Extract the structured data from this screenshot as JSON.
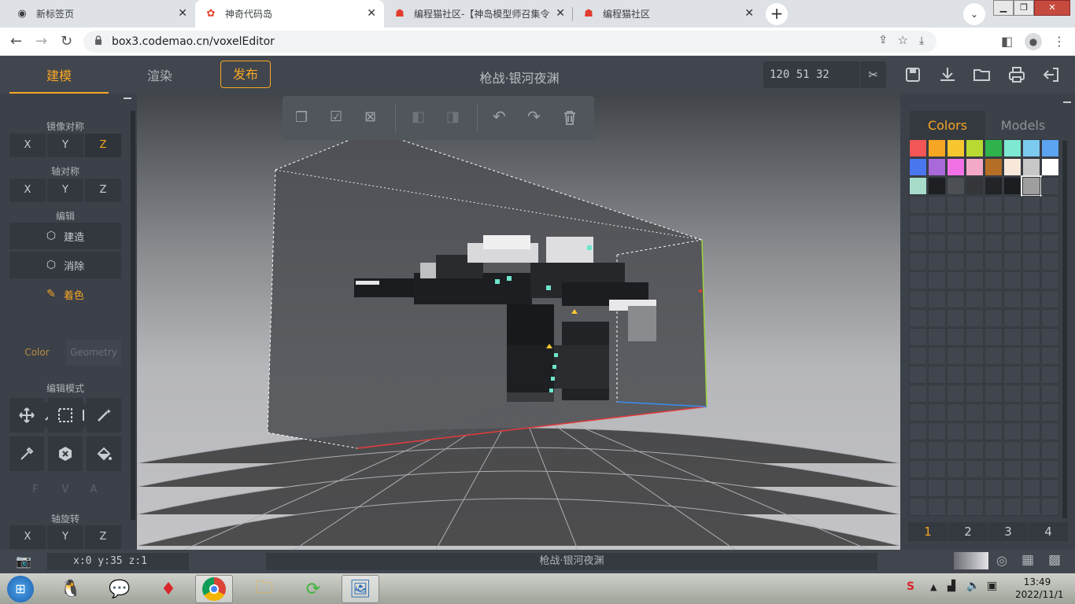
{
  "browser": {
    "tabs": [
      {
        "title": "新标签页",
        "icon": "chrome-icon"
      },
      {
        "title": "神奇代码岛",
        "icon": "codemao-icon"
      },
      {
        "title": "编程猫社区-【神岛模型师召集令",
        "icon": "cat-icon"
      },
      {
        "title": "编程猫社区",
        "icon": "cat-icon"
      }
    ],
    "url": "box3.codemao.cn/voxelEditor"
  },
  "app": {
    "modes": [
      "建模",
      "渲染"
    ],
    "publish": "发布",
    "title": "枪战·银河夜渊",
    "coords": "120 51 32"
  },
  "left": {
    "mirror_label": "镜像对称",
    "axis_label": "轴对称",
    "edit_label": "编辑",
    "axes": [
      "X",
      "Y",
      "Z"
    ],
    "build": "建造",
    "erase": "消除",
    "paint": "着色",
    "color_tab": "Color",
    "geometry_tab": "Geometry",
    "edit_mode_label": "编辑模式",
    "fva": [
      "F",
      "V",
      "A"
    ],
    "rotate_label": "轴旋转"
  },
  "right": {
    "tabs": [
      "Colors",
      "Models"
    ],
    "palette": [
      "#f25656",
      "#f5a623",
      "#f8c72f",
      "#b8d932",
      "#2fb24c",
      "#7fe8d2",
      "#7ccbef",
      "#5ca3f2",
      "#4a76f0",
      "#a86ad8",
      "#f272e6",
      "#f4a8c8",
      "#b56e26",
      "#f8e8da",
      "#c7c7c7",
      "#ffffff",
      "#a7dccb",
      "#1e1f22",
      "#4c4f54",
      "#35363a",
      "#232427",
      "#1c1d20",
      "#9e9e9e"
    ],
    "pages": [
      "1",
      "2",
      "3",
      "4"
    ]
  },
  "status": {
    "pos": "x:0  y:35  z:1",
    "name": "枪战·银河夜渊"
  },
  "taskbar": {
    "time": "13:49",
    "date": "2022/11/1"
  },
  "colors": {
    "accent": "#f5a623"
  }
}
